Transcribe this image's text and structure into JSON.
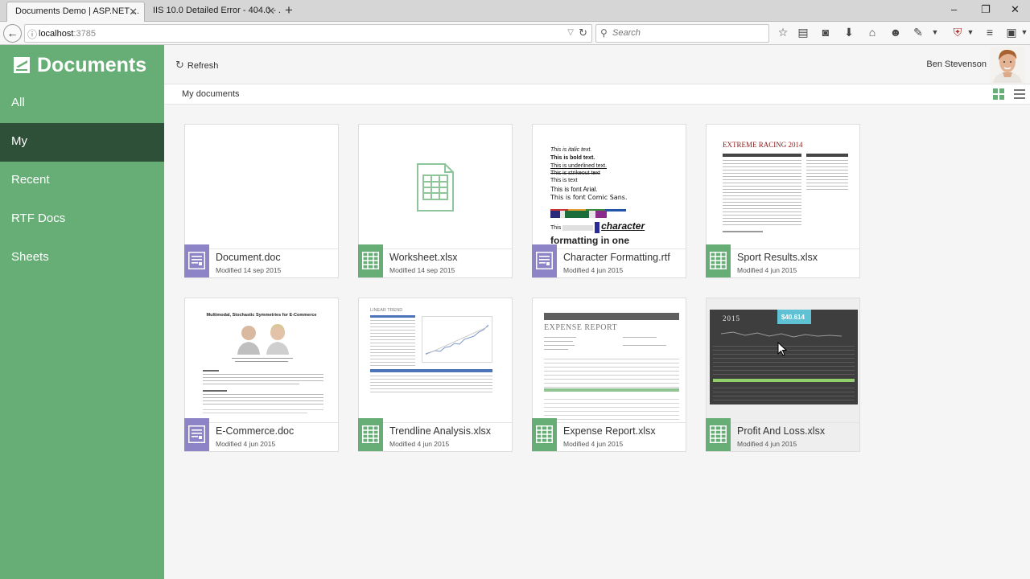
{
  "browser": {
    "tabs": [
      {
        "title": "Documents Demo | ASP.NET ...",
        "active": true
      },
      {
        "title": "IIS 10.0 Detailed Error - 404.0 - ...",
        "active": false
      }
    ],
    "url_host": "localhost",
    "url_port": ":3785",
    "search_placeholder": "Search"
  },
  "sidebar": {
    "brand": "Documents",
    "items": [
      {
        "label": "All",
        "active": false
      },
      {
        "label": "My",
        "active": true
      },
      {
        "label": "Recent",
        "active": false
      },
      {
        "label": "RTF Docs",
        "active": false
      },
      {
        "label": "Sheets",
        "active": false
      }
    ]
  },
  "toolbar": {
    "refresh_label": "Refresh",
    "user_name": "Ben Stevenson"
  },
  "breadcrumb": {
    "label": "My documents"
  },
  "documents": [
    {
      "name": "Document.doc",
      "modified": "Modified 14 sep 2015",
      "type": "doc"
    },
    {
      "name": "Worksheet.xlsx",
      "modified": "Modified 14 sep 2015",
      "type": "xls"
    },
    {
      "name": "Character Formatting.rtf",
      "modified": "Modified 4 jun 2015",
      "type": "doc"
    },
    {
      "name": "Sport Results.xlsx",
      "modified": "Modified 4 jun 2015",
      "type": "xls"
    },
    {
      "name": "E-Commerce.doc",
      "modified": "Modified 4 jun 2015",
      "type": "doc"
    },
    {
      "name": "Trendline Analysis.xlsx",
      "modified": "Modified 4 jun 2015",
      "type": "xls"
    },
    {
      "name": "Expense Report.xlsx",
      "modified": "Modified 4 jun 2015",
      "type": "xls"
    },
    {
      "name": "Profit And Loss.xlsx",
      "modified": "Modified 4 jun 2015",
      "type": "xls"
    }
  ],
  "thumbnails": {
    "character_formatting": {
      "line1": "This is italic text.",
      "line2": "This is bold text.",
      "line3": "This is underlined text.",
      "line4": "This is strikeout text",
      "line5": "This is text",
      "line6": "This is font Arial.",
      "line7": "This is font Comic Sans.",
      "line8": "This",
      "line9": "character",
      "line10": "formatting in one"
    },
    "sport_results": {
      "title": "EXTREME RACING 2014"
    },
    "ecommerce": {
      "title": "Multimodal, Stochastic Symmetries for E-Commerce"
    },
    "trendline": {
      "title": "LINEAR TREND"
    },
    "expense": {
      "title": "EXPENSE REPORT"
    },
    "profit": {
      "year": "2015",
      "amount": "$40.614"
    }
  },
  "colors": {
    "sidebar": "#67ae76",
    "sidebar_active": "#2e4f38",
    "doc_icon": "#8d83c7",
    "sheet_icon": "#67ae76"
  }
}
